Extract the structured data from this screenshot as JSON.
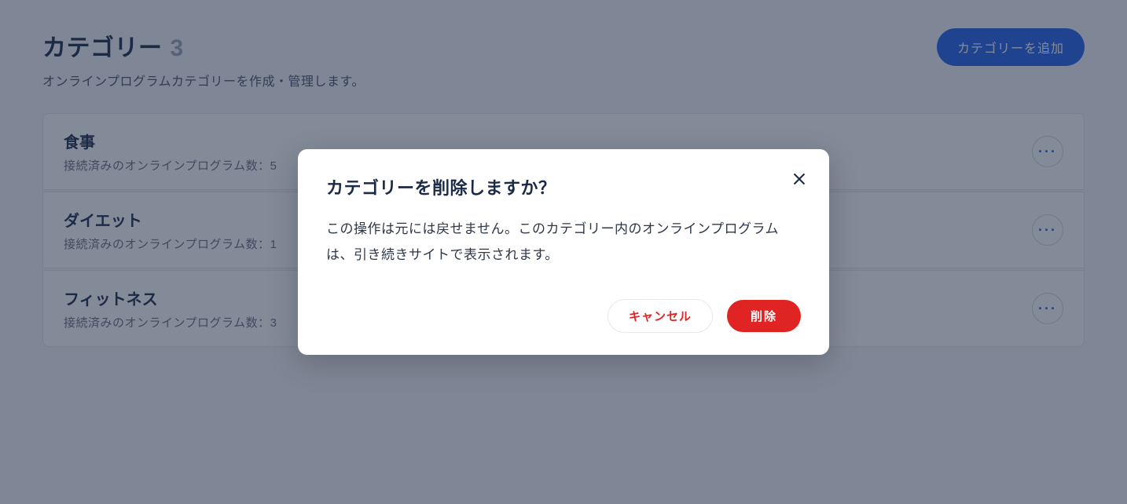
{
  "header": {
    "title": "カテゴリー",
    "count": "3",
    "subtitle": "オンラインプログラムカテゴリーを作成・管理します。",
    "add_label": "カテゴリーを追加"
  },
  "categories": [
    {
      "name": "食事",
      "meta": "接続済みのオンラインプログラム数：5"
    },
    {
      "name": "ダイエット",
      "meta": "接続済みのオンラインプログラム数：1"
    },
    {
      "name": "フィットネス",
      "meta": "接続済みのオンラインプログラム数：3"
    }
  ],
  "modal": {
    "title": "カテゴリーを削除しますか？",
    "body": "この操作は元には戻せません。このカテゴリー内のオンラインプログラムは、引き続きサイトで表示されます。",
    "cancel_label": "キャンセル",
    "delete_label": "削除"
  }
}
